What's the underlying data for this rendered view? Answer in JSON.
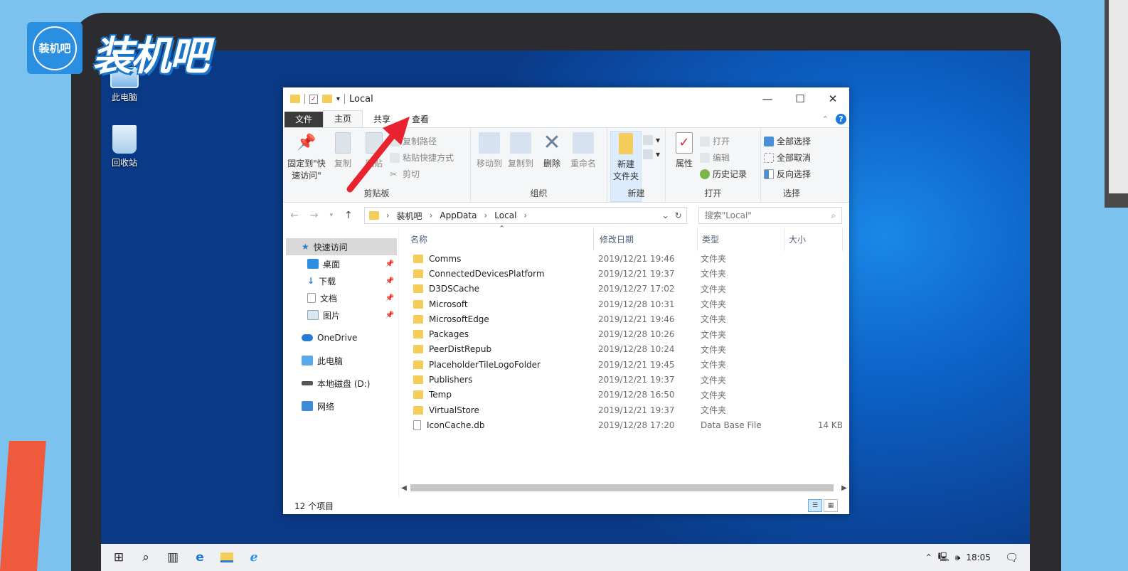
{
  "brand": {
    "logo_text": "装机吧",
    "wordmark": "装机吧"
  },
  "desktop": {
    "icons": [
      {
        "label": "此电脑"
      },
      {
        "label": "回收站"
      }
    ]
  },
  "window": {
    "title": "Local",
    "tabs": [
      "文件",
      "主页",
      "共享",
      "查看"
    ],
    "ribbon": {
      "clipboard": {
        "label": "剪贴板",
        "pin": "固定到\"快\n速访问\"",
        "copy": "复制",
        "paste": "粘贴",
        "copy_path": "复制路径",
        "paste_shortcut": "粘贴快捷方式",
        "cut": "剪切"
      },
      "organize": {
        "label": "组织",
        "move_to": "移动到",
        "copy_to": "复制到",
        "delete": "删除",
        "rename": "重命名"
      },
      "new": {
        "label": "新建",
        "new_folder": "新建\n文件夹"
      },
      "open": {
        "label": "打开",
        "properties": "属性",
        "open": "打开",
        "edit": "编辑",
        "history": "历史记录"
      },
      "select": {
        "label": "选择",
        "select_all": "全部选择",
        "select_none": "全部取消",
        "invert": "反向选择"
      }
    },
    "address": {
      "crumbs": [
        "装机吧",
        "AppData",
        "Local"
      ],
      "search_placeholder": "搜索\"Local\""
    },
    "nav": {
      "quick_access": "快速访问",
      "quick_items": [
        "桌面",
        "下载",
        "文档",
        "图片"
      ],
      "onedrive": "OneDrive",
      "this_pc": "此电脑",
      "local_disk": "本地磁盘 (D:)",
      "network": "网络"
    },
    "columns": {
      "name": "名称",
      "date": "修改日期",
      "type": "类型",
      "size": "大小"
    },
    "files": [
      {
        "name": "Comms",
        "date": "2019/12/21 19:46",
        "type": "文件夹",
        "size": ""
      },
      {
        "name": "ConnectedDevicesPlatform",
        "date": "2019/12/21 19:37",
        "type": "文件夹",
        "size": ""
      },
      {
        "name": "D3DSCache",
        "date": "2019/12/27 17:02",
        "type": "文件夹",
        "size": ""
      },
      {
        "name": "Microsoft",
        "date": "2019/12/28 10:31",
        "type": "文件夹",
        "size": ""
      },
      {
        "name": "MicrosoftEdge",
        "date": "2019/12/21 19:46",
        "type": "文件夹",
        "size": ""
      },
      {
        "name": "Packages",
        "date": "2019/12/28 10:26",
        "type": "文件夹",
        "size": ""
      },
      {
        "name": "PeerDistRepub",
        "date": "2019/12/28 10:24",
        "type": "文件夹",
        "size": ""
      },
      {
        "name": "PlaceholderTileLogoFolder",
        "date": "2019/12/21 19:45",
        "type": "文件夹",
        "size": ""
      },
      {
        "name": "Publishers",
        "date": "2019/12/21 19:37",
        "type": "文件夹",
        "size": ""
      },
      {
        "name": "Temp",
        "date": "2019/12/28 16:50",
        "type": "文件夹",
        "size": ""
      },
      {
        "name": "VirtualStore",
        "date": "2019/12/21 19:37",
        "type": "文件夹",
        "size": ""
      },
      {
        "name": "IconCache.db",
        "date": "2019/12/28 17:20",
        "type": "Data Base File",
        "size": "14 KB"
      }
    ],
    "status": "12 个项目"
  },
  "taskbar": {
    "time": "18:05"
  },
  "colors": {
    "accent": "#1a7ae0",
    "folder": "#f5cd5b",
    "arrow": "#e8232f",
    "file_tab": "#3b3b3b"
  }
}
